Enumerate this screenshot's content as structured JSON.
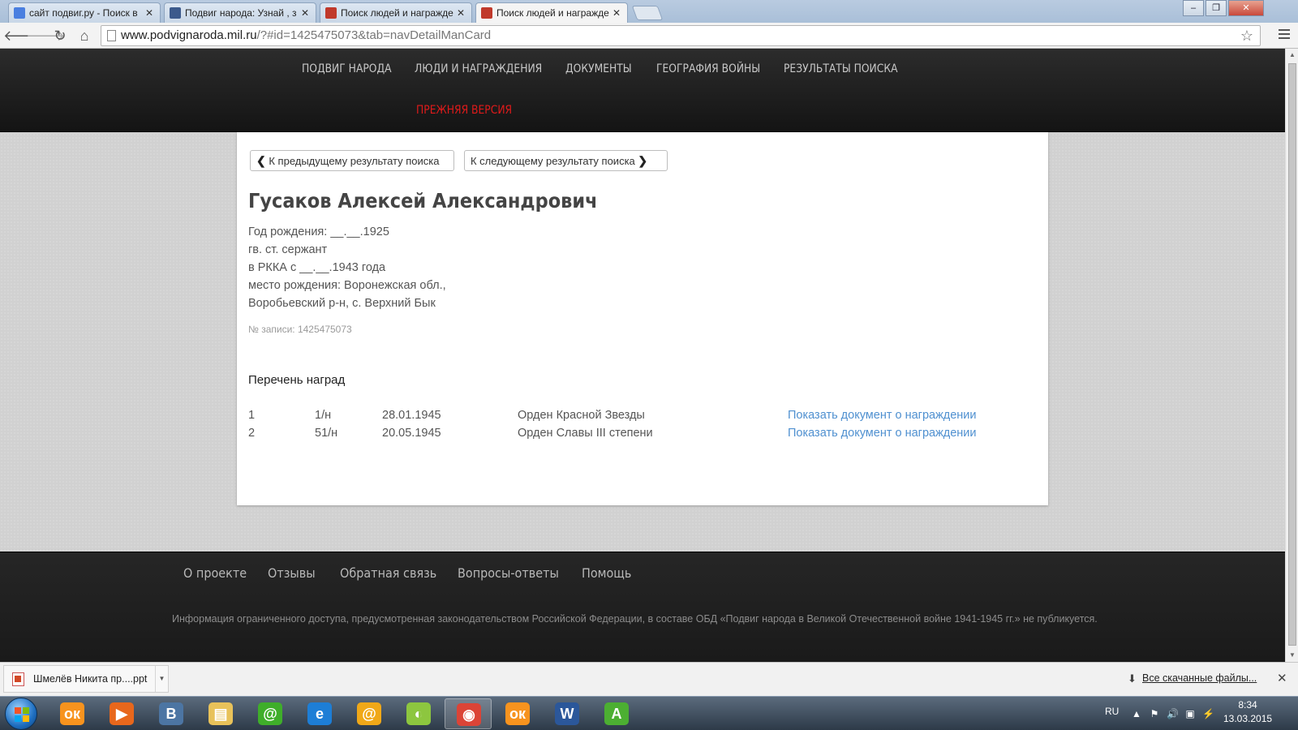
{
  "browser": {
    "tabs": [
      {
        "title": "сайт подвиг.ру - Поиск в",
        "favicon_color": "#4a7fe0",
        "active": false
      },
      {
        "title": "Подвиг народа: Узнай , з",
        "favicon_color": "#3c5a8c",
        "active": false
      },
      {
        "title": "Поиск людей и награжде",
        "favicon_color": "#c0392b",
        "active": false
      },
      {
        "title": "Поиск людей и награжде",
        "favicon_color": "#c0392b",
        "active": true
      }
    ],
    "tab_close": "✕",
    "window_controls": {
      "minimize": "–",
      "maximize": "❐",
      "close": "✕"
    },
    "url_host": "www.podvignaroda.mil.ru",
    "url_path": "/?#id=1425475073&tab=navDetailManCard",
    "icons": {
      "back": "🡐",
      "forward": "🡒",
      "reload": "↻",
      "home": "⌂",
      "star": "☆"
    }
  },
  "site": {
    "nav": [
      {
        "label": "ПОДВИГ НАРОДА"
      },
      {
        "label": "ЛЮДИ И НАГРАЖДЕНИЯ"
      },
      {
        "label": "ДОКУМЕНТЫ"
      },
      {
        "label": "ГЕОГРАФИЯ ВОЙНЫ"
      },
      {
        "label": "РЕЗУЛЬТАТЫ ПОИСКА"
      }
    ],
    "old_version": "ПРЕЖНЯЯ ВЕРСИЯ",
    "accent_red": "#e01a1a",
    "link_blue": "#4f90d0"
  },
  "card": {
    "prev_label": "К предыдущему результату поиска",
    "next_label": "К следующему результату поиска",
    "name": "Гусаков Алексей Александрович",
    "info": {
      "birth_year": "Год рождения: __.__.1925",
      "rank": "гв. ст. сержант",
      "service": "в РККА с __.__.1943 года",
      "birthplace_1": "место рождения: Воронежская обл.,",
      "birthplace_2": "Воробьевский р-н, с. Верхний Бык"
    },
    "record_no": "№ записи: 1425475073",
    "awards_title": "Перечень наград",
    "awards": [
      {
        "num": "1",
        "doc": "1/н",
        "date": "28.01.1945",
        "name": "Орден Красной Звезды",
        "link": "Показать документ о награждении"
      },
      {
        "num": "2",
        "doc": "51/н",
        "date": "20.05.1945",
        "name": "Орден Славы III степени",
        "link": "Показать документ о награждении"
      }
    ]
  },
  "footer": {
    "links": [
      {
        "label": "О проекте"
      },
      {
        "label": "Отзывы"
      },
      {
        "label": "Обратная связь"
      },
      {
        "label": "Вопросы-ответы"
      },
      {
        "label": "Помощь"
      }
    ],
    "notice": "Информация ограниченного доступа, предусмотренная законодательством Российской Федерации, в составе ОБД «Подвиг народа в Великой Отечественной войне 1941-1945 гг.» не публикуется."
  },
  "downloads": {
    "file_name": "Шмелёв Никита пр....ppt",
    "show_all": "Все скачанные файлы...",
    "close": "✕"
  },
  "taskbar": {
    "apps": [
      {
        "name": "odnoklassniki",
        "glyph": "ок",
        "color": "#f7931e"
      },
      {
        "name": "media-player",
        "glyph": "▶",
        "color": "#e8671c"
      },
      {
        "name": "vkontakte",
        "glyph": "В",
        "color": "#4c75a3"
      },
      {
        "name": "file-explorer",
        "glyph": "▤",
        "color": "#e8c25a"
      },
      {
        "name": "icq",
        "glyph": "@",
        "color": "#3fae2a"
      },
      {
        "name": "internet-explorer",
        "glyph": "e",
        "color": "#1d7ed6"
      },
      {
        "name": "mail-agent",
        "glyph": "@",
        "color": "#f0a818"
      },
      {
        "name": "amigo",
        "glyph": "◐",
        "color": "#8dc63f"
      },
      {
        "name": "chrome",
        "glyph": "◉",
        "color": "#db4437"
      },
      {
        "name": "odnoklassniki-2",
        "glyph": "ок",
        "color": "#f7931e"
      },
      {
        "name": "word",
        "glyph": "W",
        "color": "#2b579a"
      },
      {
        "name": "green-app",
        "glyph": "А",
        "color": "#4caf32"
      }
    ],
    "lang": "RU",
    "time": "8:34",
    "date": "13.03.2015"
  }
}
